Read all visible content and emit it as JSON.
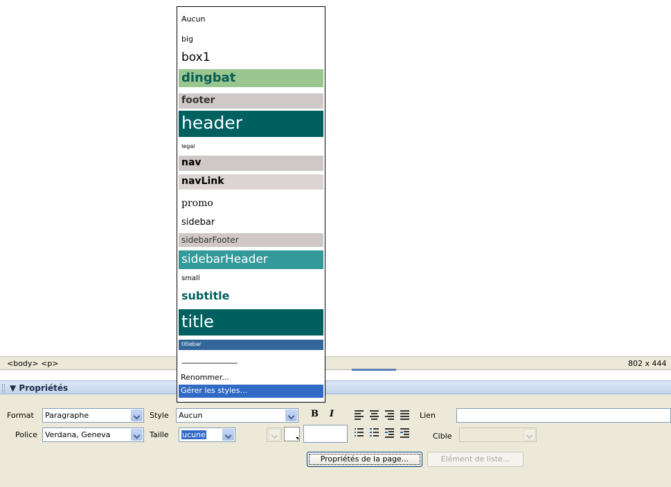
{
  "tagbar": {
    "tags": "<body> <p>",
    "size": "802 x 444"
  },
  "panel": {
    "title": "Propriétés"
  },
  "row1": {
    "format_label": "Format",
    "format_value": "Paragraphe",
    "style_label": "Style",
    "style_value": "Aucun",
    "lien_label": "Lien"
  },
  "row2": {
    "police_label": "Police",
    "police_value": "Verdana, Geneva",
    "taille_label": "Taille",
    "taille_value": "ucune",
    "cible_label": "Cible"
  },
  "buttons": {
    "page_props": "Propriétés de la page...",
    "list_item": "Elément de liste..."
  },
  "style_dropdown": {
    "options": [
      "Aucun",
      "big",
      "box1",
      "dingbat",
      "footer",
      "header",
      "legal",
      "nav",
      "navLink",
      "promo",
      "sidebar",
      "sidebarFooter",
      "sidebarHeader",
      "small",
      "subtitle",
      "title",
      "titlebar"
    ],
    "separator": "---------------------------",
    "rename": "Renommer...",
    "manage": "Gérer les styles..."
  },
  "icons": {
    "bold": "B",
    "italic": "I",
    "align_left": "align-left-icon",
    "align_center": "align-center-icon",
    "align_right": "align-right-icon",
    "align_justify": "align-justify-icon",
    "unordered_list": "unordered-list-icon",
    "ordered_list": "ordered-list-icon",
    "outdent": "outdent-icon",
    "indent": "indent-icon"
  },
  "colors": {
    "selection": "#316ac5",
    "teal_dark": "#006060",
    "teal_mid": "#339999",
    "green_light": "#99c68f",
    "gray_rose": "#d0c8c8",
    "blue_bar": "#336699"
  }
}
